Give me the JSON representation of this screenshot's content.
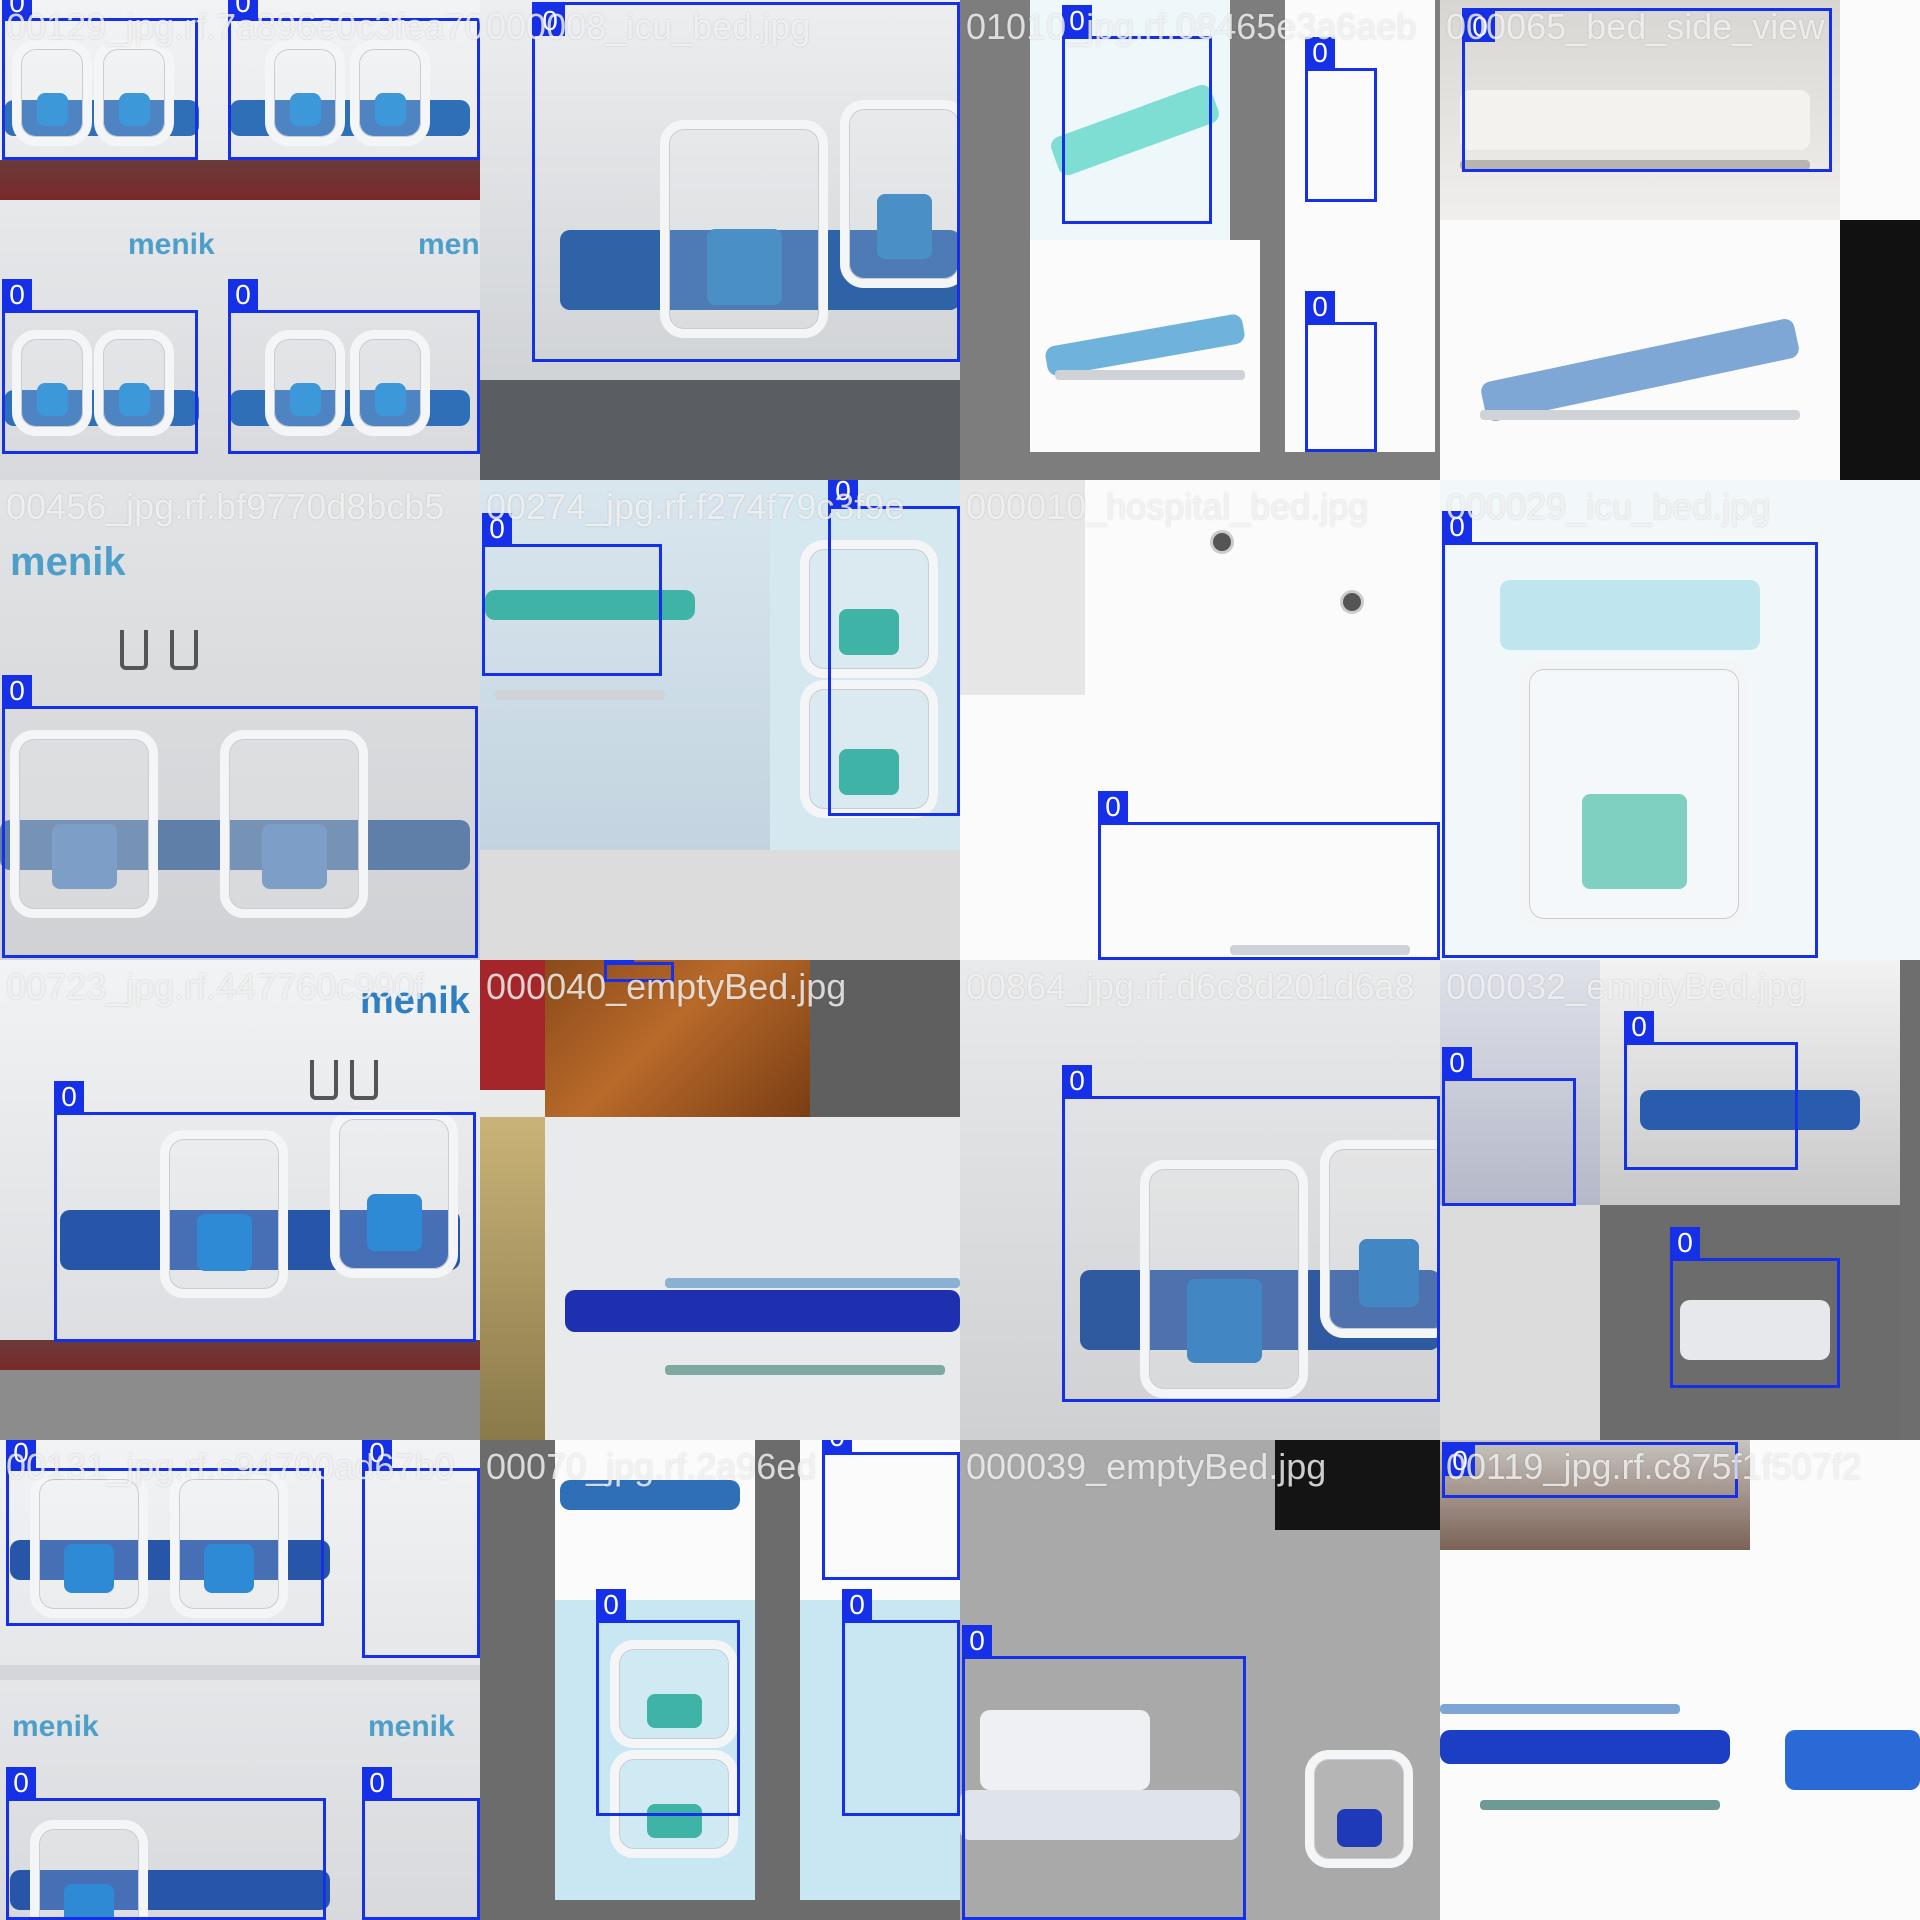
{
  "class_tag": "0",
  "colors": {
    "box": "#1530e6",
    "label_text": "#f5f5f5"
  },
  "tiles": [
    {
      "filename": "00129_jpg.rf.7a896e0c3fea70"
    },
    {
      "filename": "000008_icu_bed.jpg"
    },
    {
      "filename": "01010_jpg.rf.08465e3a6aeb"
    },
    {
      "filename": "000065_bed_side_view"
    },
    {
      "filename": "00456_jpg.rf.bf9770d8bcb5"
    },
    {
      "filename": "00274_jpg.rf.f274f79c3f9e"
    },
    {
      "filename": "000010_hospital_bed.jpg"
    },
    {
      "filename": "000029_icu_bed.jpg"
    },
    {
      "filename": "00723_jpg.rf.447760c990f"
    },
    {
      "filename": "000040_emptyBed.jpg"
    },
    {
      "filename": "00864_jpg.rf.d6c8d201d6a8"
    },
    {
      "filename": "000032_emptyBed.jpg"
    },
    {
      "filename": "00131_jpg.rf.c94700ad67b0"
    },
    {
      "filename": "00070_jpg.rf.2a96ed"
    },
    {
      "filename": "000039_emptyBed.jpg"
    },
    {
      "filename": "00119_jpg.rf.c875f1f507f2"
    }
  ],
  "brand": "menik"
}
